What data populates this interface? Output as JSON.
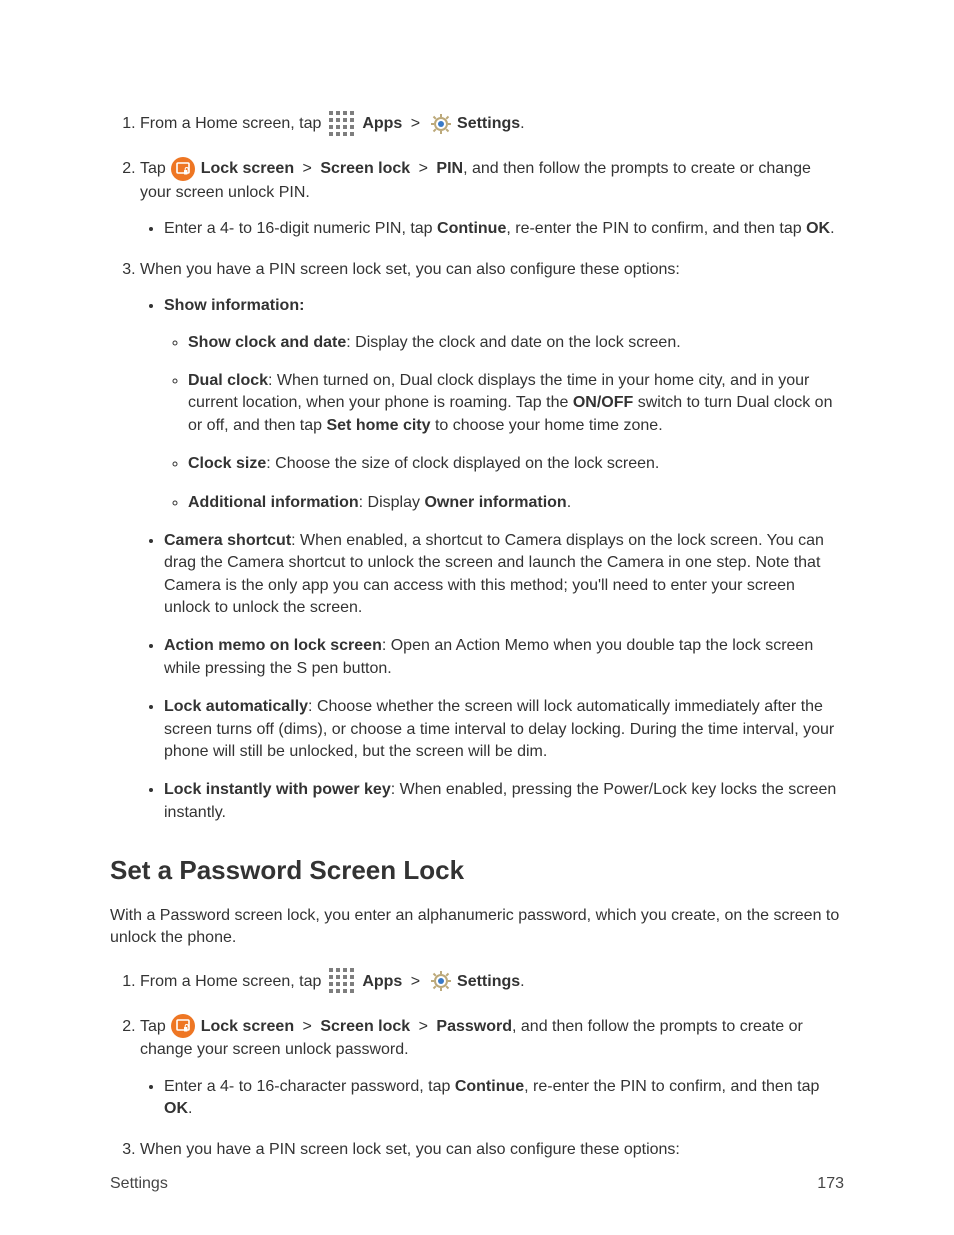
{
  "step1": {
    "prefix": "From a Home screen, tap",
    "apps_label": "Apps",
    "gt": ">",
    "settings_label": "Settings",
    "period": "."
  },
  "step2_pin": {
    "tap": "Tap",
    "lock_screen": "Lock screen",
    "screen_lock": "Screen lock",
    "gt": ">",
    "pin": "PIN",
    "tail": ", and then follow the prompts to create or change your screen unlock PIN.",
    "sub_enter_pre": "Enter a 4- to 16-digit numeric PIN, tap ",
    "continue": "Continue",
    "sub_enter_mid": ", re-enter the PIN to confirm, and then tap ",
    "ok": "OK",
    "period": "."
  },
  "step3_pin": {
    "intro": "When you have a PIN screen lock set, you can also configure these options:",
    "show_info_label": "Show information:",
    "clock_date_label": "Show clock and date",
    "clock_date_text": ": Display the clock and date on the lock screen.",
    "dual_clock_label": "Dual clock",
    "dual_clock_pre": ": When turned on, Dual clock displays the time in your home city, and in your current location, when your phone is roaming. Tap the ",
    "onoff": "ON/OFF",
    "dual_clock_mid": " switch to turn Dual clock on or off, and then tap ",
    "set_home_city": "Set home city",
    "dual_clock_tail": " to choose your home time zone.",
    "clock_size_label": "Clock size",
    "clock_size_text": ": Choose the size of clock displayed on the lock screen.",
    "additional_label": "Additional information",
    "additional_pre": ": Display ",
    "owner_info": "Owner information",
    "additional_tail": ".",
    "camera_label": "Camera shortcut",
    "camera_text": ": When enabled, a shortcut to Camera displays on the lock screen. You can drag the Camera shortcut to unlock the screen and launch the Camera in one step. Note that Camera is the only app you can access with this method; you'll need to enter your screen unlock to unlock the screen.",
    "action_label": "Action memo on lock screen",
    "action_text": ": Open an Action Memo when you double tap the lock screen while pressing the S pen button.",
    "lock_auto_label": "Lock automatically",
    "lock_auto_text": ": Choose whether the screen will lock automatically immediately after the screen turns off (dims), or choose a time interval to delay locking. During the time interval, your phone will still be unlocked, but the screen will be dim.",
    "lock_instant_label": "Lock instantly with power key",
    "lock_instant_text": ": When enabled, pressing the Power/Lock key locks the screen instantly."
  },
  "heading_password": "Set a Password Screen Lock",
  "password_intro": "With a Password screen lock, you enter an alphanumeric password, which you create, on the screen to unlock the phone.",
  "step2_password": {
    "tap": "Tap",
    "lock_screen": "Lock screen",
    "screen_lock": "Screen lock",
    "gt": ">",
    "password": "Password",
    "tail": ", and then follow the prompts to create or change your screen unlock password.",
    "sub_enter_pre": "Enter a 4- to 16-character password, tap ",
    "continue": "Continue",
    "sub_enter_mid": ", re-enter the PIN to confirm, and then tap ",
    "ok": "OK",
    "period": "."
  },
  "step3_password": {
    "intro": "When you have a PIN screen lock set, you can also configure these options:"
  },
  "footer": {
    "section": "Settings",
    "page": "173"
  },
  "icons": {
    "apps": "apps-grid-icon",
    "settings": "settings-gear-icon",
    "lock": "lock-screen-icon"
  }
}
